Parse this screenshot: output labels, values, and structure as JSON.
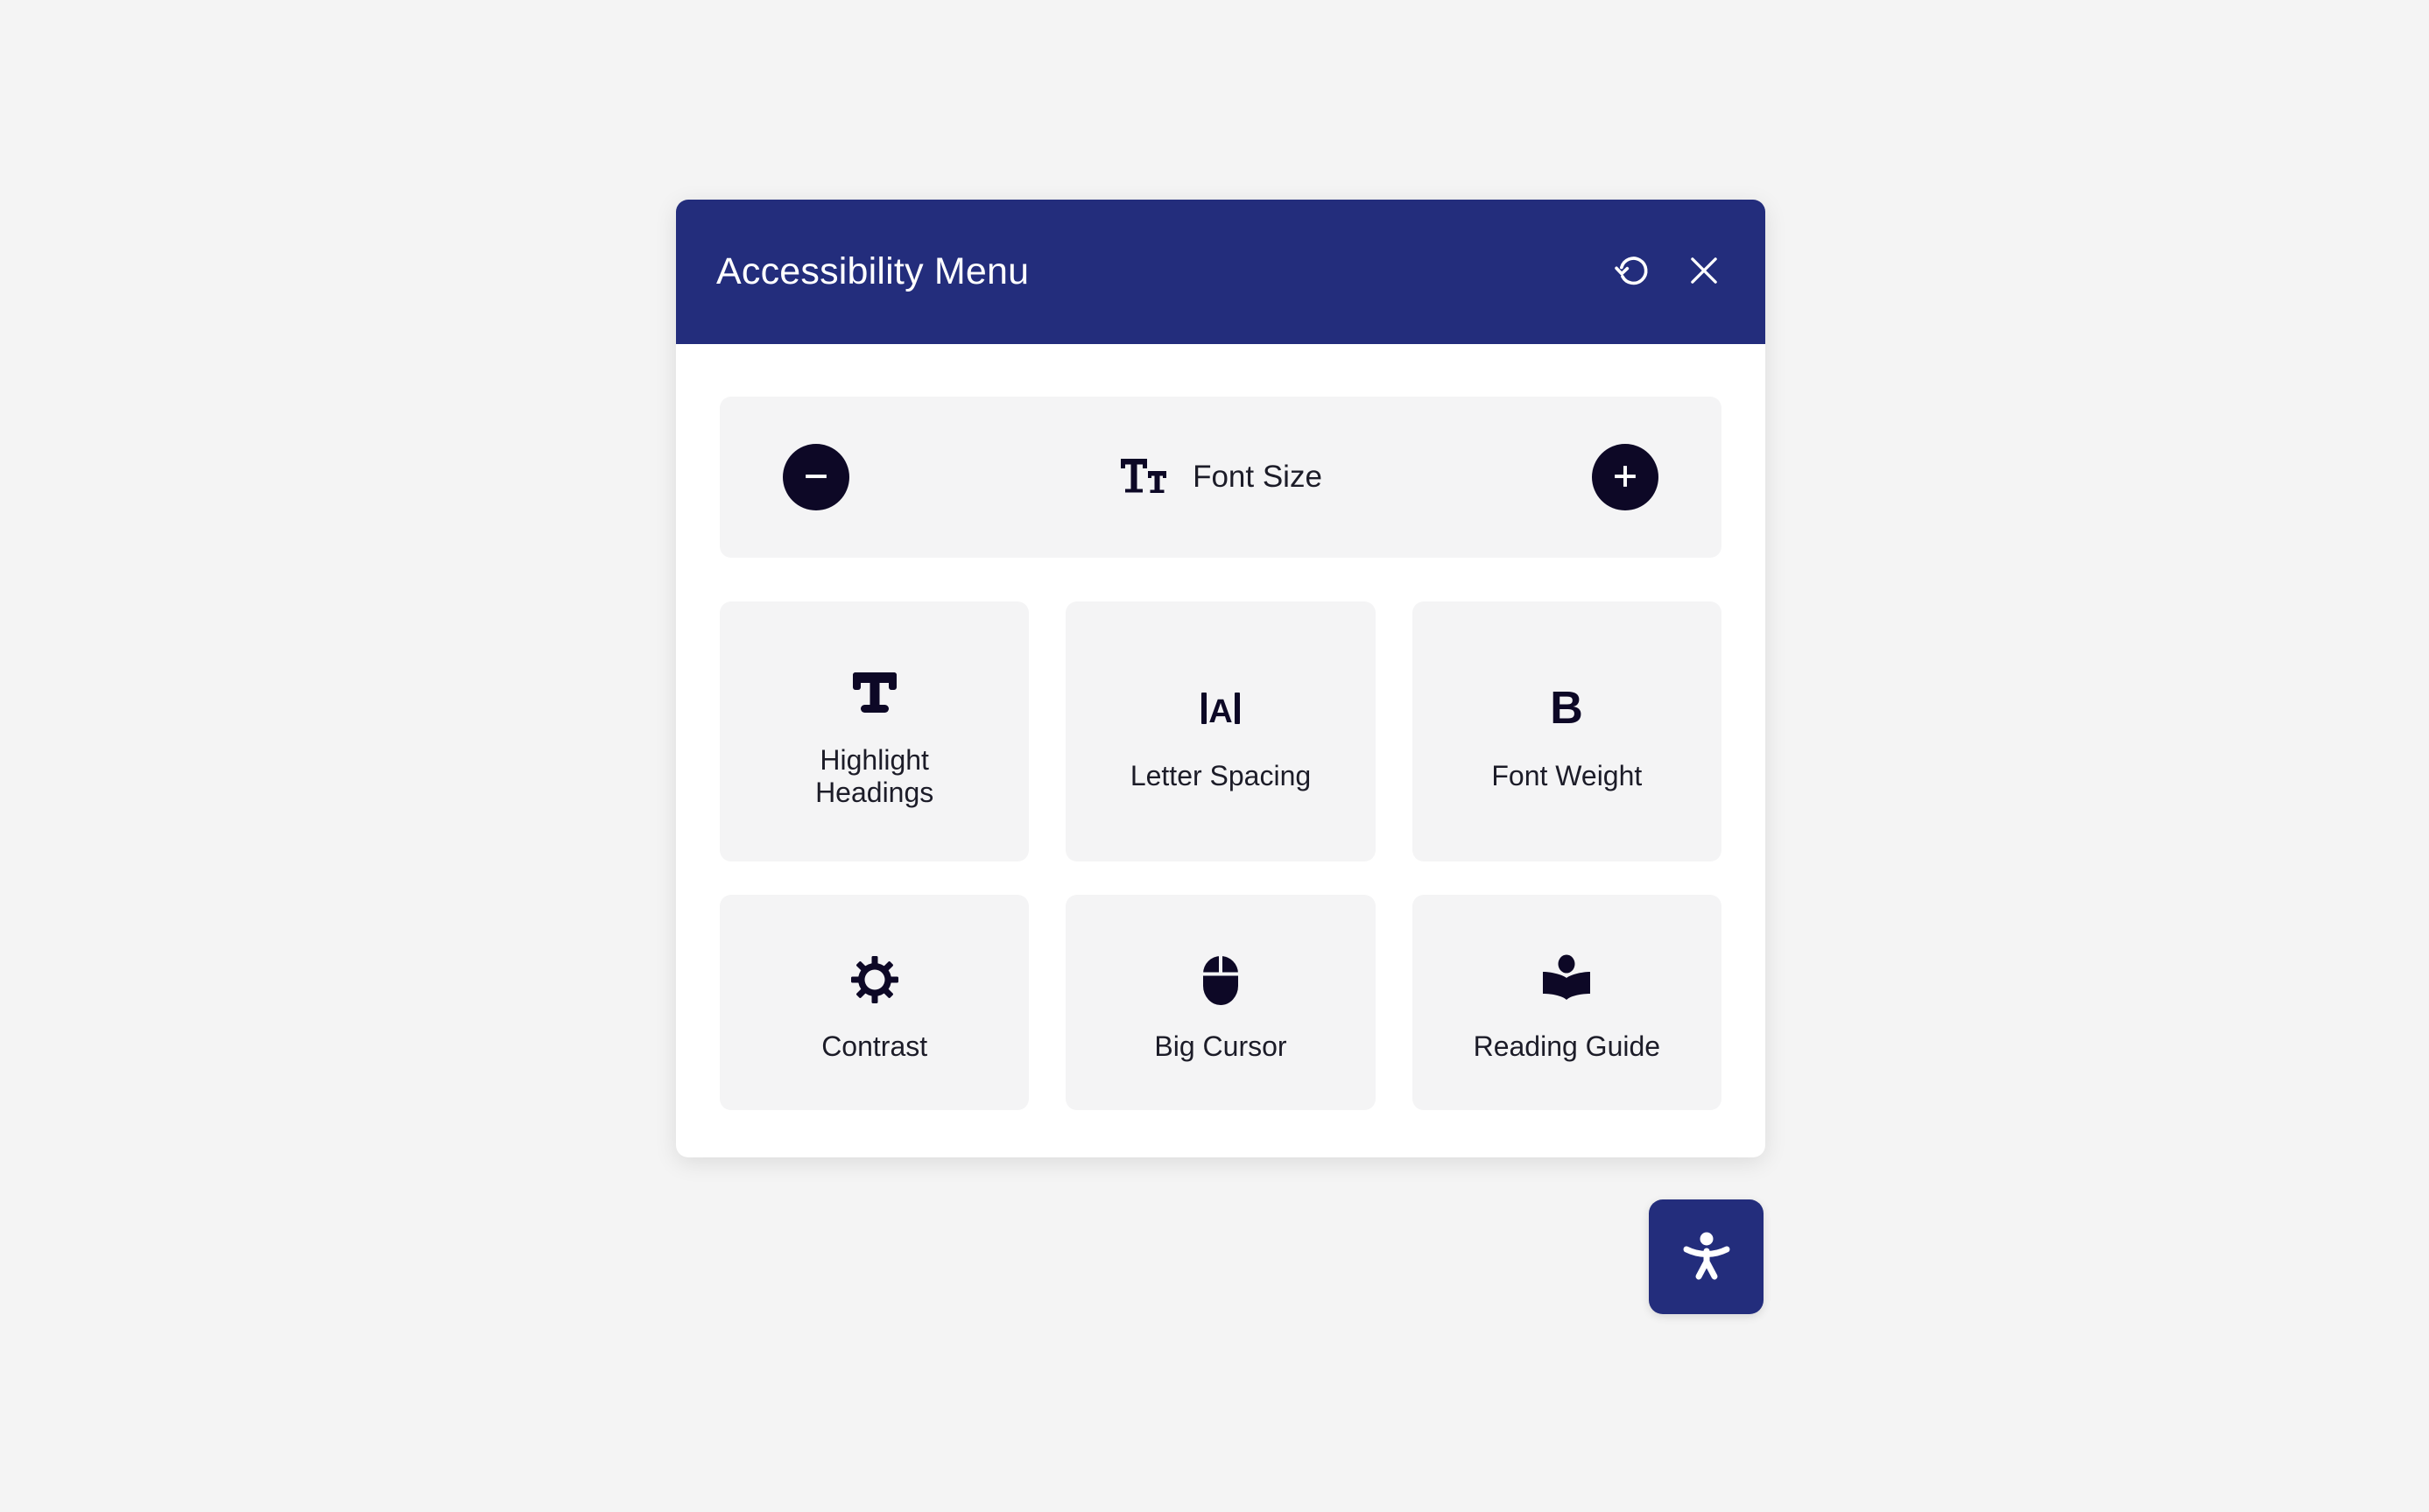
{
  "colors": {
    "page_background": "#f4f4f4",
    "panel_background": "#ffffff",
    "header_navy": "#232d7c",
    "tile_background": "#f4f4f5",
    "icon_dark": "#0d0826",
    "text_dark": "#1c1c28",
    "on_navy_text": "#ffffff"
  },
  "header": {
    "title": "Accessibility Menu",
    "reset_icon": "reset-circular-arrow-icon",
    "close_icon": "close-x-icon"
  },
  "font_size_control": {
    "label": "Font Size",
    "icon": "font-size-tt-icon",
    "decrease_icon": "minus-icon",
    "increase_icon": "plus-icon",
    "decrease_label": "",
    "increase_label": ""
  },
  "tiles": [
    {
      "label": "Highlight\nHeadings",
      "icon": "serif-capital-t-icon",
      "name": "highlight-headings"
    },
    {
      "label": "Letter Spacing",
      "icon": "letter-spacing-bars-a-icon",
      "name": "letter-spacing"
    },
    {
      "label": "Font Weight",
      "icon": "bold-b-icon",
      "name": "font-weight"
    },
    {
      "label": "Contrast",
      "icon": "gear-contrast-icon",
      "name": "contrast"
    },
    {
      "label": "Big Cursor",
      "icon": "mouse-icon",
      "name": "big-cursor"
    },
    {
      "label": "Reading Guide",
      "icon": "open-book-reader-icon",
      "name": "reading-guide"
    }
  ],
  "launcher": {
    "icon": "accessibility-person-icon",
    "label": ""
  }
}
